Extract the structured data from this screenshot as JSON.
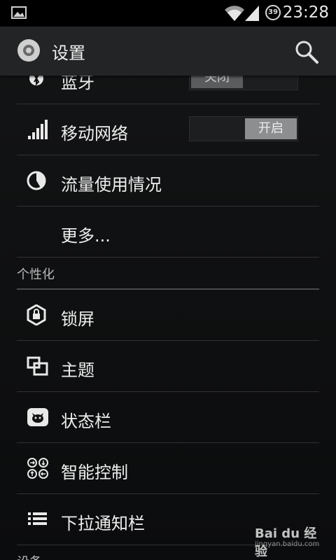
{
  "status_bar": {
    "time": "23:28",
    "battery": "39"
  },
  "action_bar": {
    "title": "设置"
  },
  "list": {
    "bluetooth": {
      "label": "蓝牙",
      "toggle": "关闭"
    },
    "mobile_network": {
      "label": "移动网络",
      "toggle": "开启"
    },
    "data_usage": {
      "label": "流量使用情况"
    },
    "more": {
      "label": "更多..."
    },
    "personalization_header": "个性化",
    "lock_screen": {
      "label": "锁屏"
    },
    "theme": {
      "label": "主题"
    },
    "status_bar_item": {
      "label": "状态栏"
    },
    "smart_control": {
      "label": "智能控制"
    },
    "notification_bar": {
      "label": "下拉通知栏"
    },
    "device_header": "设备"
  },
  "watermark": {
    "main": "Bai du 经验",
    "sub": "jingyan.baidu.com"
  }
}
